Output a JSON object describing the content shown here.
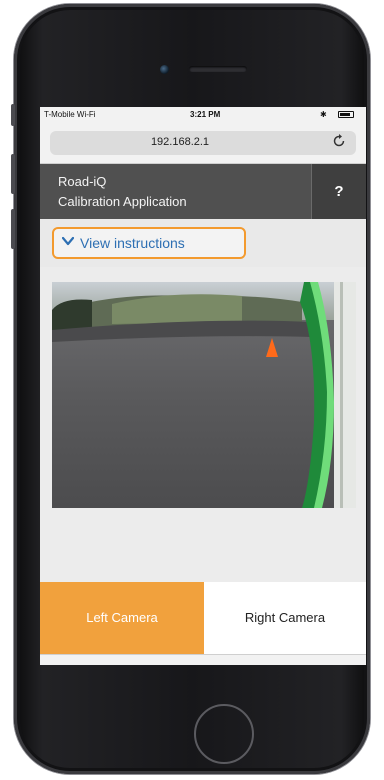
{
  "status_bar": {
    "carrier": "T-Mobile Wi-Fi",
    "time": "3:21 PM",
    "bluetooth": "✱"
  },
  "browser": {
    "url": "192.168.2.1",
    "reload_icon": "reload-icon"
  },
  "app": {
    "title_line1": "Road-iQ",
    "title_line2": "Calibration Application",
    "help_label": "?",
    "instructions_label": "View instructions",
    "left_camera_label": "Left Camera",
    "right_camera_label": "Right Camera"
  },
  "toolbar": {
    "icons": [
      "back-icon",
      "forward-icon",
      "share-icon",
      "bookmarks-icon",
      "tabs-icon"
    ]
  },
  "colors": {
    "accent_orange": "#f1a13d",
    "highlight_border": "#f39a2e",
    "link_blue": "#2d6fb3",
    "header_gray": "#505050"
  }
}
